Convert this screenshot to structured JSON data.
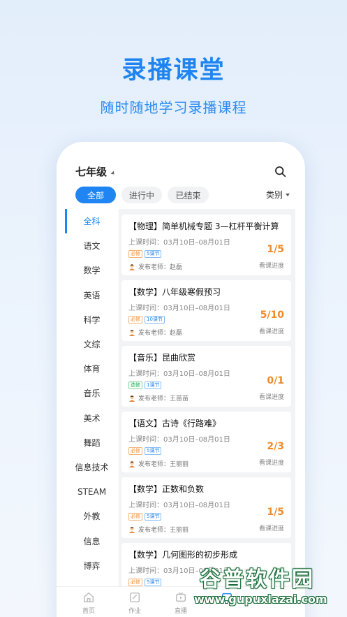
{
  "hero": {
    "title": "录播课堂",
    "subtitle": "随时随地学习录播课程"
  },
  "header": {
    "grade": "七年级",
    "search_icon": "search-icon"
  },
  "filters": {
    "tabs": [
      "全部",
      "进行中",
      "已结束"
    ],
    "selected": "全部",
    "category_label": "类别"
  },
  "subjects": [
    "全科",
    "语文",
    "数学",
    "英语",
    "科学",
    "文综",
    "体育",
    "音乐",
    "美术",
    "舞蹈",
    "信息技术",
    "STEAM",
    "外教",
    "信息",
    "博弈"
  ],
  "selected_subject": "全科",
  "courses": [
    {
      "title": "【物理】简单机械专题 3—杠杆平衡计算",
      "time": "上课时间：03月10日–08月01日",
      "tag_type": "必修",
      "tag_count": "5课节",
      "teacher": "发布老师：赵磊",
      "progress": "1/5",
      "progress_label": "看课进度"
    },
    {
      "title": "【数学】八年级寒假预习",
      "time": "上课时间：03月10日–08月01日",
      "tag_type": "必修",
      "tag_count": "10课节",
      "teacher": "发布老师：赵磊",
      "progress": "5/10",
      "progress_label": "看课进度"
    },
    {
      "title": "【音乐】昆曲欣赏",
      "time": "上课时间：03月10日–08月01日",
      "tag_type": "选修",
      "tag_count": "1课节",
      "teacher": "发布老师：王苗苗",
      "progress": "0/1",
      "progress_label": "看课进度"
    },
    {
      "title": "【语文】古诗《行路难》",
      "time": "上课时间：03月10日–08月01日",
      "tag_type": "必修",
      "tag_count": "5课节",
      "teacher": "发布老师：王丽丽",
      "progress": "2/3",
      "progress_label": "看课进度"
    },
    {
      "title": "【数学】正数和负数",
      "time": "上课时间：03月10日–08月01日",
      "tag_type": "必修",
      "tag_count": "5课节",
      "teacher": "发布老师：王丽丽",
      "progress": "1/5",
      "progress_label": "看课进度"
    },
    {
      "title": "【数学】几何图形的初步形成",
      "time": "上课时间：03月10日–08月01日",
      "tag_type": "必修",
      "tag_count": "5课节",
      "teacher": "",
      "progress": "",
      "progress_label": ""
    }
  ],
  "tabbar": {
    "items": [
      "首页",
      "作业",
      "直播",
      ""
    ]
  },
  "watermark": {
    "logo": "谷普软件园",
    "url": "www.gupuxlazai.com"
  },
  "colors": {
    "accent": "#1e85f3",
    "progress": "#f08a2a",
    "required_tag": "#f08a2a",
    "elective_tag": "#19a84b"
  }
}
